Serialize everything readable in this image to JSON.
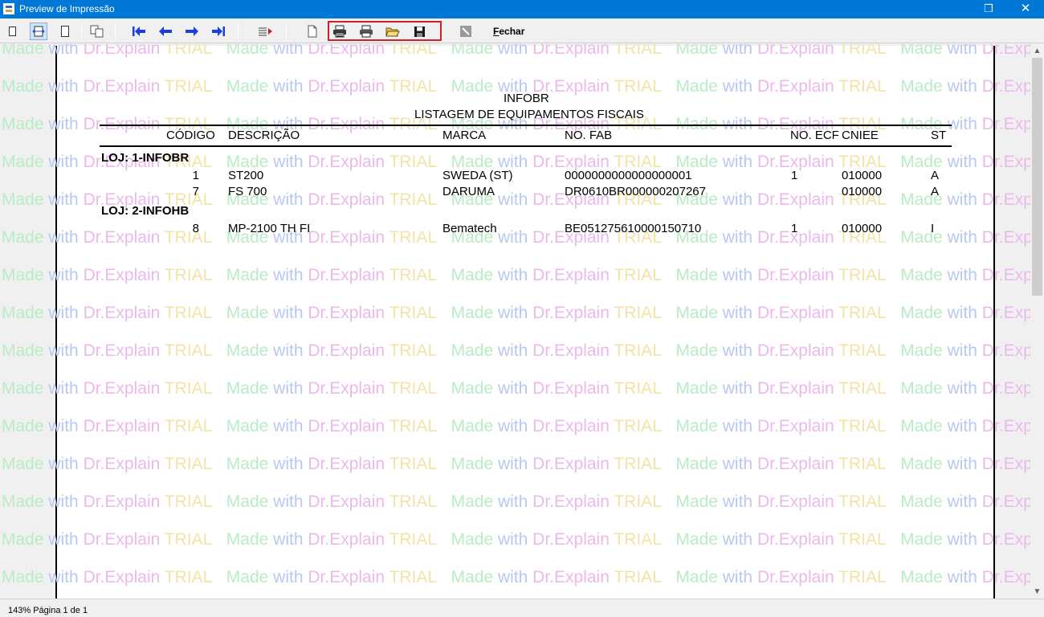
{
  "window": {
    "title": "Preview de Impressão",
    "restore_glyph": "❐",
    "close_glyph": "✕"
  },
  "toolbar": {
    "close_label_underlined": "F",
    "close_label_rest": "echar",
    "highlight_color": "#d0202a",
    "icons": [
      "single-page-icon",
      "page-width-icon",
      "full-page-icon",
      "multi-page-icon",
      "first-page-icon",
      "previous-page-icon",
      "next-page-icon",
      "last-page-icon",
      "goto-page-icon",
      "page-setup-icon",
      "printer-setup-icon",
      "print-icon",
      "open-icon",
      "save-icon",
      "stop-icon"
    ]
  },
  "report": {
    "title": "INFOBR",
    "subtitle": "LISTAGEM DE EQUIPAMENTOS FISCAIS",
    "headers": {
      "codigo": "CÓDIGO",
      "descricao": "DESCRIÇÃO",
      "marca": "MARCA",
      "nofab": "NO. FAB",
      "noecf": "NO. ECF",
      "cniee": "CNIEE",
      "st": "ST"
    },
    "groups": [
      {
        "label": "LOJ: 1-INFOBR",
        "rows": [
          {
            "codigo": "1",
            "descricao": "ST200",
            "marca": "SWEDA (ST)",
            "nofab": "0000000000000000001",
            "noecf": "1",
            "cniee": "010000",
            "st": "A"
          },
          {
            "codigo": "7",
            "descricao": "FS 700",
            "marca": "DARUMA",
            "nofab": "DR0610BR000000207267",
            "noecf": "",
            "cniee": "010000",
            "st": "A"
          }
        ]
      },
      {
        "label": "LOJ: 2-INFOHB",
        "rows": [
          {
            "codigo": "8",
            "descricao": "MP-2100 TH FI",
            "marca": "Bematech",
            "nofab": "BE051275610000150710",
            "noecf": "1",
            "cniee": "010000",
            "st": "I"
          }
        ]
      }
    ]
  },
  "watermark": {
    "made": "Made",
    "with": "with",
    "dr": "Dr.Explain",
    "trial": "TRIAL"
  },
  "status": {
    "text": "143% Página 1 de 1"
  },
  "colors": {
    "titlebar": "#0078d7",
    "nav_arrow": "#1a3fe0"
  }
}
